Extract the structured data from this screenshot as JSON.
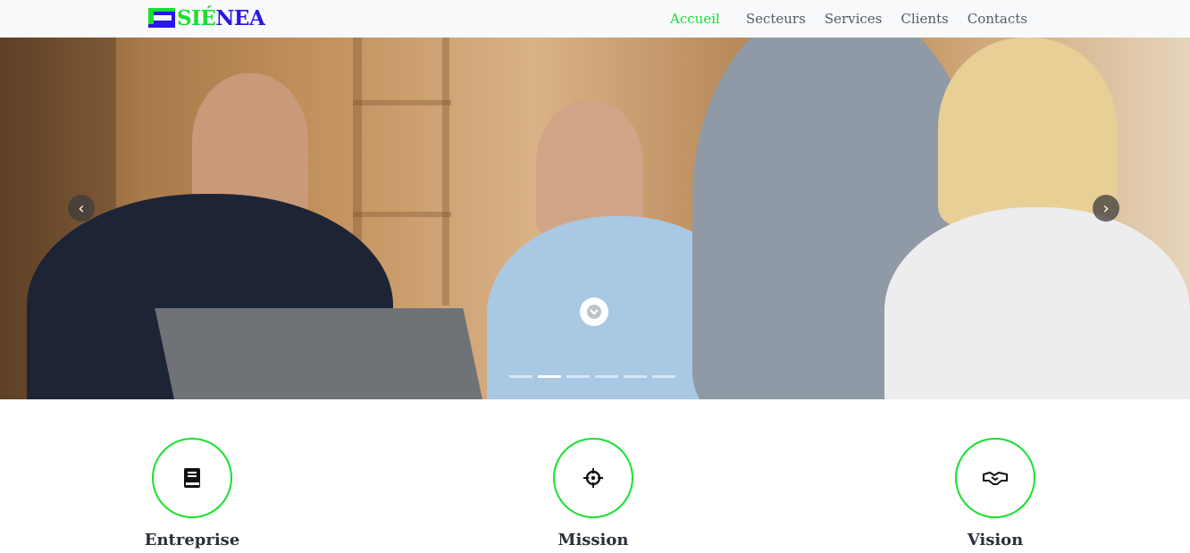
{
  "logo": {
    "part1": "SIÉ",
    "part2": "NEA"
  },
  "nav": {
    "items": [
      {
        "label": "Accueil",
        "active": true
      },
      {
        "label": "Secteurs"
      },
      {
        "label": "Services"
      },
      {
        "label": "Clients"
      },
      {
        "label": "Contacts"
      }
    ]
  },
  "hero": {
    "icons": {
      "prev": "chevron-left-icon",
      "next": "chevron-right-icon",
      "scroll": "chevron-down-icon"
    },
    "slides_count": 6,
    "active_slide": 1
  },
  "features": [
    {
      "title": "Entreprise",
      "icon": "book-icon"
    },
    {
      "title": "Mission",
      "icon": "crosshair-icon"
    },
    {
      "title": "Vision",
      "icon": "handshake-icon"
    }
  ],
  "colors": {
    "accent_green": "#16e02f",
    "brand_blue": "#2a16e6",
    "nav_text": "#555a66"
  }
}
